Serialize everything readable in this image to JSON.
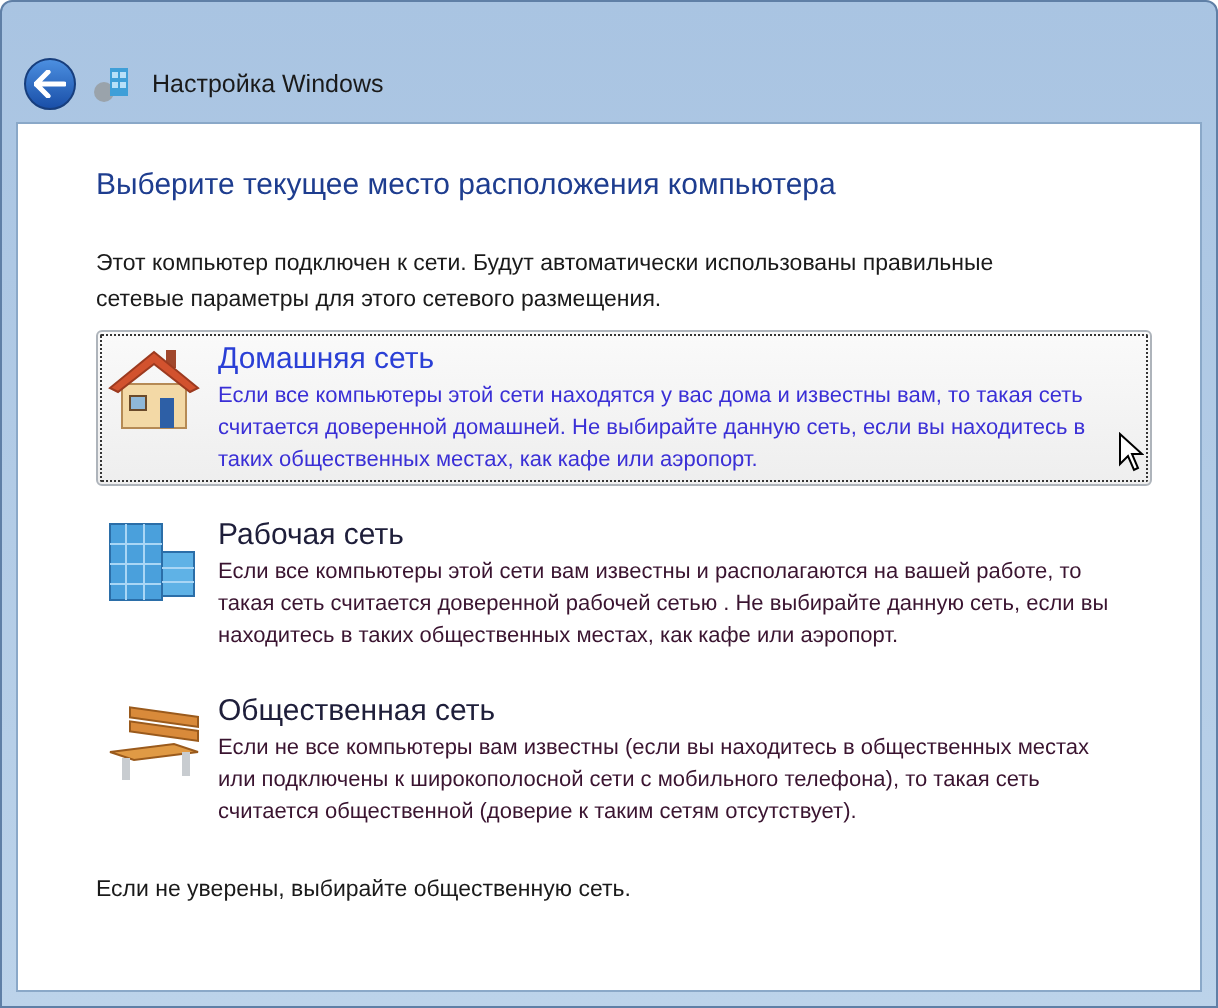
{
  "window": {
    "title": "Настройка Windows"
  },
  "heading": "Выберите текущее место расположения компьютера",
  "intro": "Этот компьютер подключен к сети. Будут автоматически использованы правильные сетевые параметры для этого сетевого размещения.",
  "options": [
    {
      "kind": "home",
      "title": "Домашняя сеть",
      "description": "Если все компьютеры этой сети находятся у вас дома и известны вам, то такая сеть считается доверенной домашней. Не выбирайте данную сеть, если вы находитесь в таких общественных местах, как кафе или аэропорт.",
      "selected": true
    },
    {
      "kind": "work",
      "title": "Рабочая сеть",
      "description": "Если все компьютеры этой сети вам известны и располагаются на вашей работе, то такая сеть считается доверенной рабочей сетью . Не выбирайте данную сеть, если вы находитесь в таких общественных местах, как кафе или аэропорт.",
      "selected": false
    },
    {
      "kind": "public",
      "title": "Общественная сеть",
      "description": "Если не все компьютеры вам известны (если вы находитесь в общественных местах или подключены к широкополосной сети с мобильного телефона), то такая сеть считается общественной (доверие к таким сетям отсутствует).",
      "selected": false
    }
  ],
  "footer": "Если не уверены, выбирайте общественную сеть."
}
